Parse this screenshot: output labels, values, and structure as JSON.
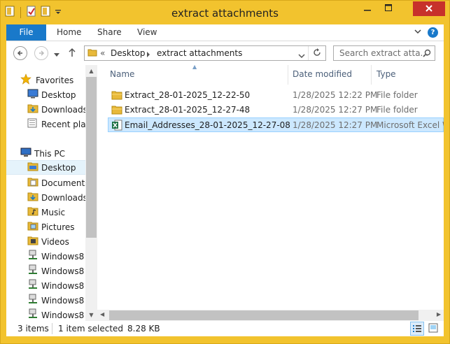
{
  "window": {
    "title": "extract attachments"
  },
  "ribbon": {
    "tabs": [
      "File",
      "Home",
      "Share",
      "View"
    ]
  },
  "navigation": {
    "breadcrumb": [
      "Desktop",
      "extract attachments"
    ],
    "search_placeholder": "Search extract atta..."
  },
  "sidebar": {
    "favorites_label": "Favorites",
    "favorites": [
      "Desktop",
      "Downloads",
      "Recent plac"
    ],
    "this_pc_label": "This PC",
    "pc_items": [
      "Desktop",
      "Documents",
      "Downloads",
      "Music",
      "Pictures",
      "Videos",
      "Windows8",
      "Windows8",
      "Windows8",
      "Windows8",
      "Windows8"
    ],
    "selected": "Desktop"
  },
  "file_list": {
    "columns": [
      "Name",
      "Date modified",
      "Type"
    ],
    "rows": [
      {
        "name": "Extract_28-01-2025_12-22-50",
        "date": "1/28/2025 12:22 PM",
        "type": "File folder",
        "icon": "folder-icon"
      },
      {
        "name": "Extract_28-01-2025_12-27-48",
        "date": "1/28/2025 12:27 PM",
        "type": "File folder",
        "icon": "folder-icon"
      },
      {
        "name": "Email_Addresses_28-01-2025_12-27-08",
        "date": "1/28/2025 12:27 PM",
        "type": "Microsoft Excel W",
        "icon": "excel-file-icon",
        "selected": true
      }
    ]
  },
  "status": {
    "item_count": "3 items",
    "selection": "1 item selected",
    "size": "8.28 KB"
  },
  "colors": {
    "accent": "#1979ca",
    "frame": "#f2c32e",
    "selection": "#cce8ff",
    "close": "#c7312b"
  }
}
